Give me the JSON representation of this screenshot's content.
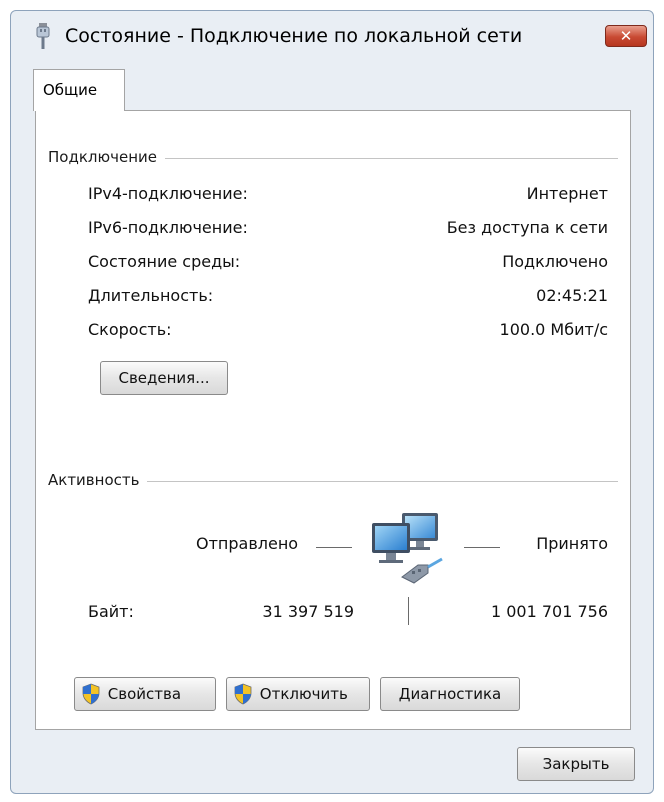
{
  "window": {
    "title": "Состояние - Подключение по локальной сети",
    "close_label": "✕"
  },
  "tabs": [
    {
      "label": "Общие",
      "active": true
    }
  ],
  "connection": {
    "header": "Подключение",
    "rows": [
      {
        "label": "IPv4-подключение:",
        "value": "Интернет"
      },
      {
        "label": "IPv6-подключение:",
        "value": "Без доступа к сети"
      },
      {
        "label": "Состояние среды:",
        "value": "Подключено"
      },
      {
        "label": "Длительность:",
        "value": "02:45:21"
      },
      {
        "label": "Скорость:",
        "value": "100.0 Мбит/с"
      }
    ],
    "details_button": "Сведения..."
  },
  "activity": {
    "header": "Активность",
    "sent_label": "Отправлено",
    "received_label": "Принято",
    "bytes_label": "Байт:",
    "bytes_sent": "31 397 519",
    "bytes_received": "1 001 701 756",
    "icon": "network-computers-icon"
  },
  "buttons": {
    "properties": "Свойства",
    "disconnect": "Отключить",
    "diagnose": "Диагностика",
    "close": "Закрыть"
  },
  "colors": {
    "window_bg": "#e9eef4",
    "close_button": "#c84a33",
    "shield_blue": "#2f6fcf",
    "shield_yellow": "#f3c325"
  }
}
